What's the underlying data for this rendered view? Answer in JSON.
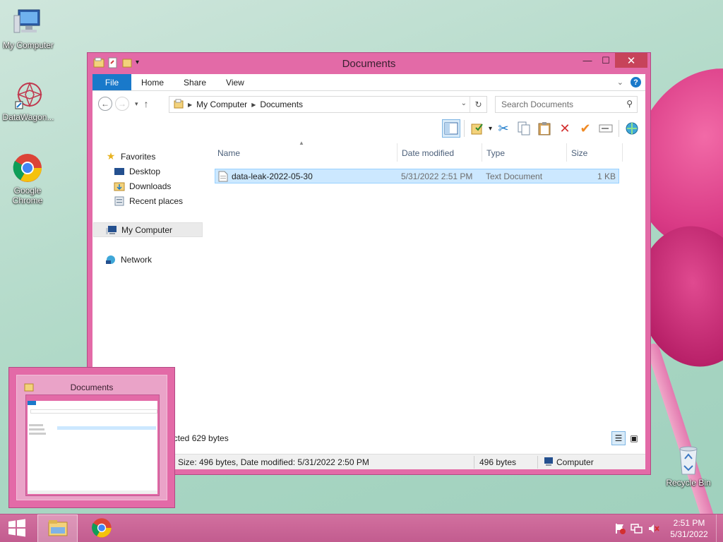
{
  "desktop": {
    "icons": [
      {
        "label": "My Computer"
      },
      {
        "label": "DataWagon..."
      },
      {
        "label": "Google Chrome"
      },
      {
        "label": "Recycle Bin"
      }
    ]
  },
  "window": {
    "title": "Documents",
    "tabs": {
      "file": "File",
      "home": "Home",
      "share": "Share",
      "view": "View"
    },
    "address": {
      "crumbs": [
        "My Computer",
        "Documents"
      ]
    },
    "search": {
      "placeholder": "Search Documents"
    },
    "nav": {
      "favorites": "Favorites",
      "desktop": "Desktop",
      "downloads": "Downloads",
      "recent": "Recent places",
      "computer": "My Computer",
      "network": "Network"
    },
    "columns": {
      "name": "Name",
      "date": "Date modified",
      "type": "Type",
      "size": "Size"
    },
    "files": [
      {
        "name": "data-leak-2022-05-30",
        "date": "5/31/2022 2:51 PM",
        "type": "Text Document",
        "size": "1 KB"
      }
    ],
    "status": {
      "selected": "ected  629 bytes",
      "details": "Size: 496 bytes, Date modified: 5/31/2022 2:50 PM",
      "bytes": "496 bytes",
      "location": "Computer"
    }
  },
  "thumbnail": {
    "title": "Documents"
  },
  "taskbar": {
    "time": "2:51 PM",
    "date": "5/31/2022"
  },
  "colors": {
    "accent": "#1979ca",
    "window_frame": "#e36aa7",
    "selection": "#cce8ff"
  }
}
